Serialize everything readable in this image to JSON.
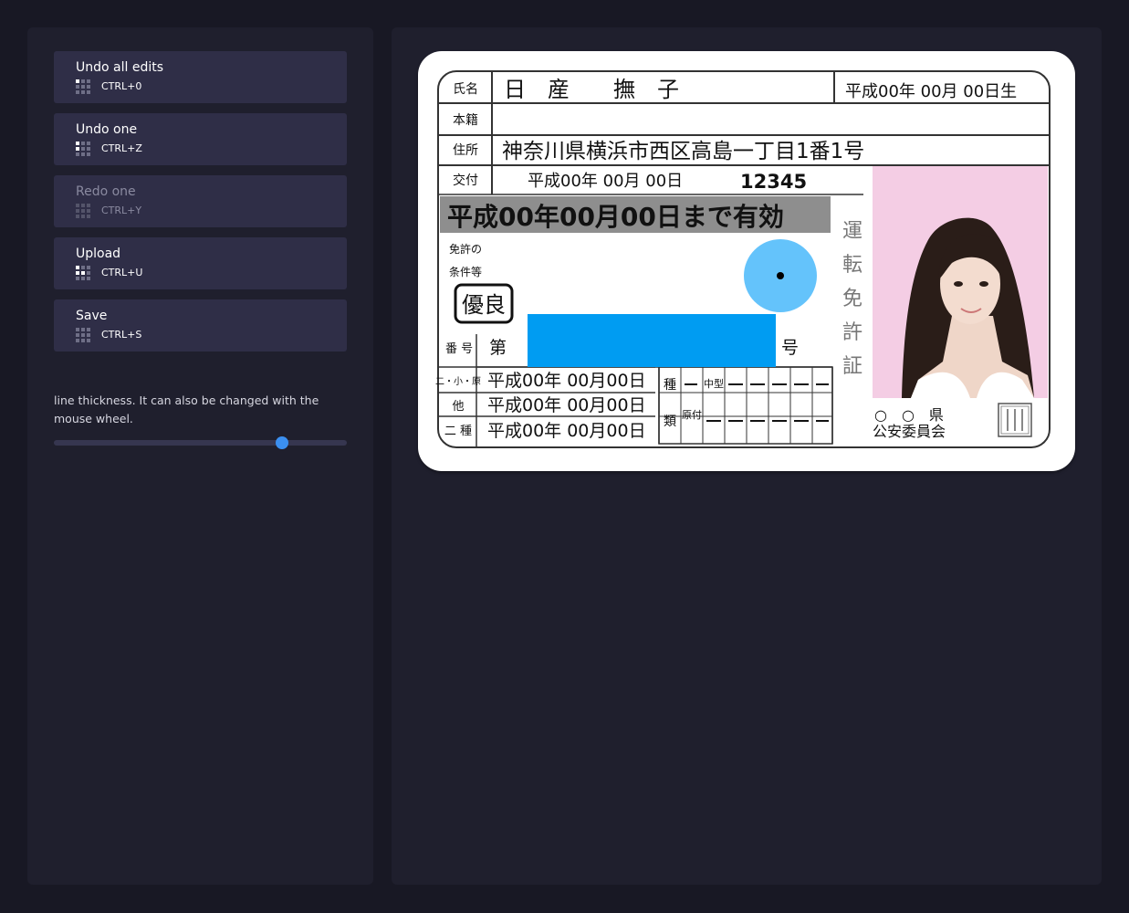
{
  "toolbar": {
    "buttons": [
      {
        "label": "Undo all edits",
        "shortcut": "CTRL+0",
        "enabled": true
      },
      {
        "label": "Undo one",
        "shortcut": "CTRL+Z",
        "enabled": true
      },
      {
        "label": "Redo one",
        "shortcut": "CTRL+Y",
        "enabled": false
      },
      {
        "label": "Upload",
        "shortcut": "CTRL+U",
        "enabled": true
      },
      {
        "label": "Save",
        "shortcut": "CTRL+S",
        "enabled": true
      }
    ],
    "icon": "shortcut-grid-icon"
  },
  "thickness": {
    "help_text": "line thickness. It can also be changed with the mouse wheel.",
    "value_fraction": 0.78
  },
  "colors": {
    "background": "#181824",
    "panel": "#1f1f2d",
    "button": "#2f2e47",
    "slider_thumb": "#3b8ff0",
    "redaction_rect": "#009cf2",
    "brush_circle": "#64c3fb",
    "photo_background": "#f4cde4"
  },
  "card": {
    "name_label": "氏名",
    "name_value": "日　産　　撫　子",
    "birth": "平成00年 00月 00日生",
    "domicile_label": "本籍",
    "address_label": "住所",
    "address_value": "神奈川県横浜市西区高島一丁目1番1号",
    "issue_label": "交付",
    "issue_date": "平成00年 00月 00日",
    "issue_number": "12345",
    "expiry": "平成00年00月00日まで有効",
    "conditions_label_1": "免許の",
    "conditions_label_2": "条件等",
    "badge": "優良",
    "number_label": "番 号",
    "number_prefix": "第",
    "number_suffix": "号",
    "title_chars": [
      "運",
      "転",
      "免",
      "許",
      "証"
    ],
    "row_labels": [
      "二・小・原",
      "他",
      "二 種"
    ],
    "row_dates": [
      "平成00年 00月00日",
      "平成00年 00月00日",
      "平成00年 00月00日"
    ],
    "type_label_1": "種",
    "type_label_2": "類",
    "middle_type": "中型",
    "original": "原付",
    "issuer_line1": "○　○　県",
    "issuer_line2": "公安委員会",
    "seal": "○○県公安委員会之印"
  }
}
